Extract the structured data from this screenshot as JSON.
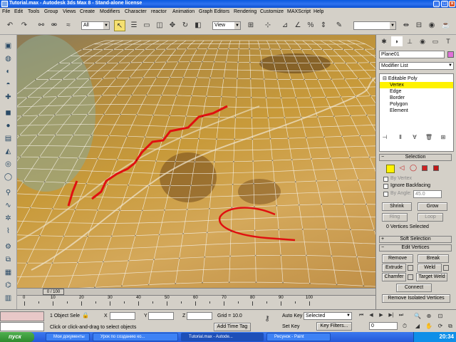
{
  "window": {
    "title": "Tutorial.max - Autodesk 3ds Max 8 - Stand-alone license"
  },
  "menu": [
    "File",
    "Edit",
    "Tools",
    "Group",
    "Views",
    "Create",
    "Modifiers",
    "Character",
    "reactor",
    "Animation",
    "Graph Editors",
    "Rendering",
    "Customize",
    "MAXScript",
    "Help"
  ],
  "toolbar": {
    "selection_filter": "All",
    "ref_coord": "View",
    "named_sel": ""
  },
  "command_panel": {
    "object_name": "Plane01",
    "modifier_list": "Modifier List",
    "stack": [
      "Editable Poly",
      "Vertex",
      "Edge",
      "Border",
      "Polygon",
      "Element"
    ],
    "selected_stack_index": 1,
    "selection_rollout": {
      "title": "Selection",
      "by_vertex": "By Vertex",
      "ignore_backfacing": "Ignore Backfacing",
      "by_angle": "By Angle:",
      "by_angle_value": "45.0",
      "shrink": "Shrink",
      "grow": "Grow",
      "ring": "Ring",
      "loop": "Loop",
      "status": "0 Vertices Selected"
    },
    "soft_selection": "Soft Selection",
    "edit_vertices": {
      "title": "Edit Vertices",
      "remove": "Remove",
      "break": "Break",
      "extrude": "Extrude",
      "weld": "Weld",
      "chamfer": "Chamfer",
      "target_weld": "Target Weld",
      "connect": "Connect",
      "remove_isolated": "Remove Isolated Vertices"
    }
  },
  "timeline": {
    "frame_display": "0 / 100",
    "ticks": [
      "0",
      "10",
      "20",
      "30",
      "40",
      "50",
      "60",
      "70",
      "80",
      "90",
      "100"
    ]
  },
  "status": {
    "selected": "1 Object Sele",
    "prompt": "Click or click-and-drag to select objects",
    "x_label": "X",
    "y_label": "Y",
    "z_label": "Z",
    "grid": "Grid = 10.0",
    "add_time_tag": "Add Time Tag",
    "auto_key": "Auto Key",
    "set_key": "Set Key",
    "key_mode": "Selected",
    "key_filters": "Key Filters...",
    "frame": "0"
  },
  "taskbar": {
    "start": "пуск",
    "tasks": [
      "Мои документы",
      "Урок по созданию ко...",
      "Tutorial.max - Autode...",
      "Рисунок - Paint"
    ],
    "clock": "20:34"
  },
  "colors": {
    "accent": "#fff200",
    "stroke_red": "#e01010"
  }
}
